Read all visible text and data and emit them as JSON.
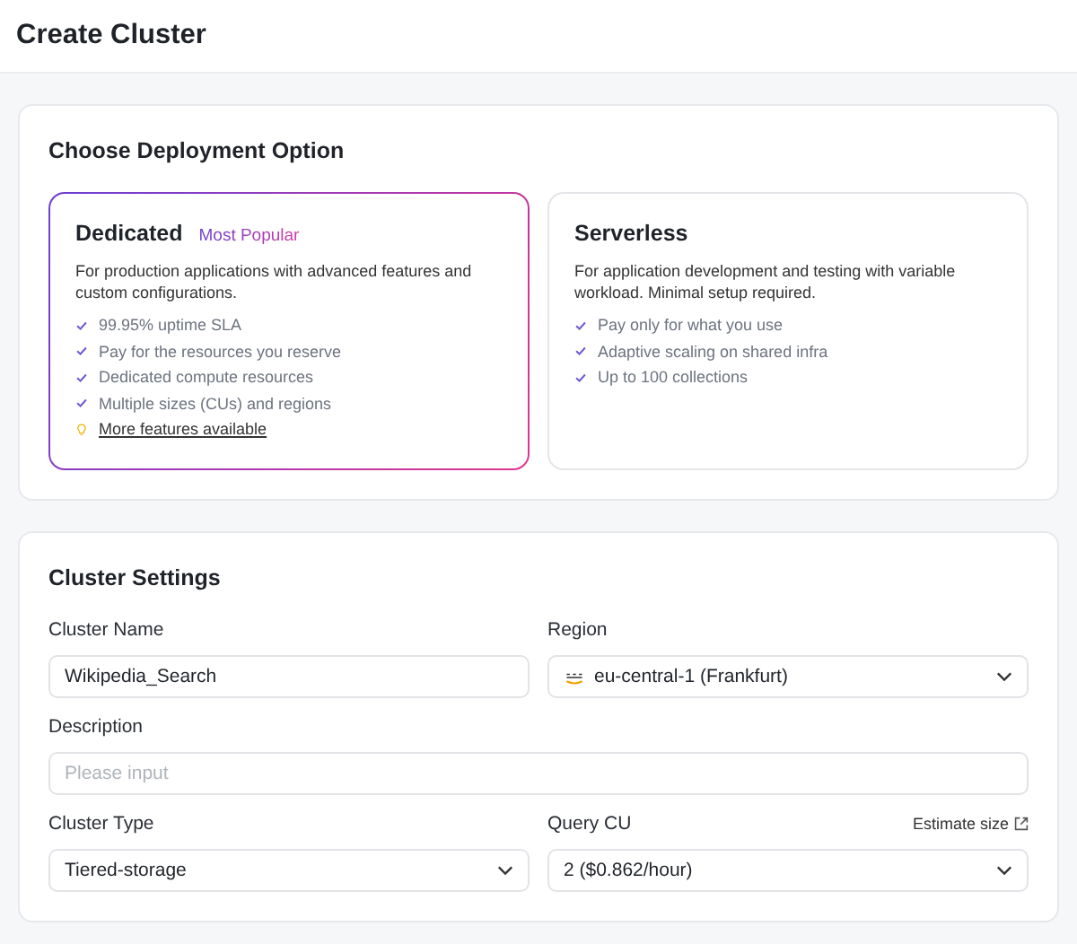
{
  "page": {
    "title": "Create Cluster"
  },
  "deployment": {
    "title": "Choose Deployment Option",
    "options": [
      {
        "name": "Dedicated",
        "badge": "Most Popular",
        "selected": true,
        "description": "For production applications with advanced features and custom configurations.",
        "features": [
          "99.95% uptime SLA",
          "Pay for the resources you reserve",
          "Dedicated compute resources",
          "Multiple sizes (CUs) and regions"
        ],
        "link": "More features available"
      },
      {
        "name": "Serverless",
        "selected": false,
        "description": "For application development and testing with variable workload. Minimal setup required.",
        "features": [
          "Pay only for what you use",
          "Adaptive scaling on shared infra",
          "Up to 100 collections"
        ]
      }
    ]
  },
  "settings": {
    "title": "Cluster Settings",
    "rows": [
      [
        {
          "label": "Cluster Name",
          "kind": "text",
          "value": "Wikipedia_Search"
        },
        {
          "label": "Region",
          "kind": "region",
          "value": "eu-central-1 (Frankfurt)"
        }
      ],
      [
        {
          "label": "Description",
          "kind": "text",
          "placeholder": "Please input"
        }
      ],
      [
        {
          "label": "Cluster Type",
          "kind": "select",
          "value": "Tiered-storage"
        },
        {
          "label": "Query CU",
          "kind": "select",
          "value": "2 ($0.862/hour)",
          "link": "Estimate size"
        }
      ]
    ]
  }
}
